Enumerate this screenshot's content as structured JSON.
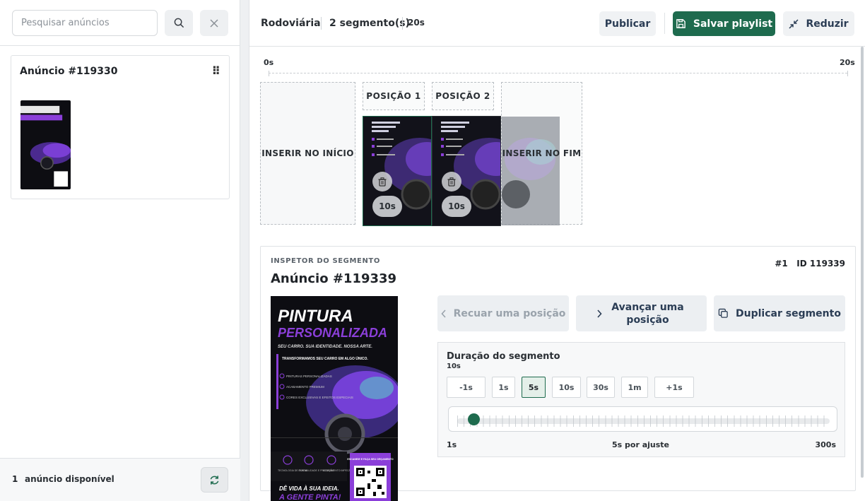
{
  "sidebar": {
    "search": {
      "placeholder": "Pesquisar anúncios",
      "value": ""
    },
    "ad_card": {
      "title": "Anúncio #119330"
    },
    "footer": {
      "count": "1",
      "label": "anúncio disponível"
    }
  },
  "header": {
    "title": "Rodoviária",
    "segments": "2 segmento(s)",
    "duration": "20s",
    "publish_label": "Publicar",
    "save_label": "Salvar playlist",
    "reduce_label": "Reduzir"
  },
  "timeline": {
    "start": "0s",
    "end": "20s",
    "insert_start": "INSERIR NO INÍCIO",
    "insert_end": "INSERIR NO FIM",
    "positions": [
      {
        "label": "POSIÇÃO 1",
        "duration": "10s"
      },
      {
        "label": "POSIÇÃO 2",
        "duration": "10s"
      }
    ]
  },
  "inspector": {
    "kicker": "INSPETOR DO SEGMENTO",
    "title": "Anúncio #119339",
    "index": "#1",
    "id_text": "ID 119339",
    "back_label": "Recuar uma posição",
    "forward_label": "Avançar uma posição",
    "duplicate_label": "Duplicar segmento",
    "duration": {
      "heading": "Duração do segmento",
      "value": "10s",
      "chips": [
        "-1s",
        "1s",
        "5s",
        "10s",
        "30s",
        "1m",
        "+1s"
      ],
      "selected_chip": "5s",
      "min_label": "1s",
      "step_label": "5s por ajuste",
      "max_label": "300s",
      "slider_value_seconds": 10
    }
  },
  "poster": {
    "headline": "PINTURA",
    "subheadline": "PERSONALIZADA",
    "tagline": "SEU CARRO. SUA IDENTIDADE. NOSSA ARTE.",
    "intro": "TRANSFORMAMOS SEU CARRO EM ALGO ÚNICO.",
    "features": [
      "PINTURAS PERSONALIZADAS",
      "ACABAMENTO PREMIUM",
      "CORES EXCLUSIVAS E EFEITOS ESPECIAIS"
    ],
    "badges": [
      "TECNOLOGIA DE PONTA",
      "DURABILIDADE E PROTEÇÃO",
      "ACABAMENTO IMPECÁVEL"
    ],
    "qr_text": "ESCANEIE E FAÇA SEU ORÇAMENTO",
    "slogan": "DÊ VIDA À SUA IDEIA.",
    "slogan2": "A GENTE PINTA!"
  },
  "colors": {
    "accent": "#1e6b4e",
    "poster_purple": "#8b3fd9",
    "poster_bg": "#0d0d12"
  }
}
